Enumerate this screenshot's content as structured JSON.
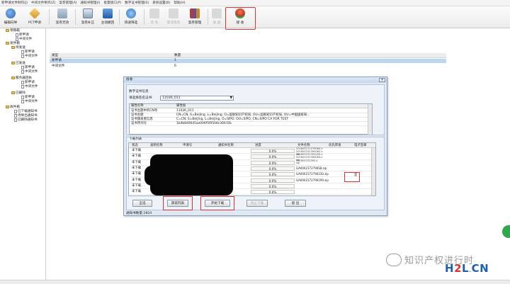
{
  "menubar": {
    "items": [
      "新申请文件制作(J)",
      "中间文件制作(Z)",
      "案卷管理(A)",
      "通知书管理(I)",
      "批量接口(P)",
      "数字证书管理(S)",
      "系统设置(B)",
      "帮助(H)"
    ]
  },
  "toolbar": {
    "buttons": [
      {
        "label": "编辑向导",
        "icon": "globe-icon",
        "color": "#3a78c8"
      },
      {
        "label": "PCT申请",
        "icon": "pct-icon",
        "color": "#e3a92e"
      },
      {
        "label": "案卷无效",
        "icon": "folder-icon",
        "color": "#8aa0b8"
      },
      {
        "label": "案卷补正",
        "icon": "doc-icon",
        "color": "#7b93b0"
      },
      {
        "label": "主动撤回",
        "icon": "note-icon",
        "color": "#2f6fc0"
      },
      {
        "label": "快速筛选",
        "icon": "filter-icon",
        "color": "#3a86c8"
      },
      {
        "label": "签 名",
        "icon": "sign-icon",
        "color": "#c8c8c8"
      },
      {
        "label": "取消签名",
        "icon": "unsign-icon",
        "color": "#c8c8c8"
      },
      {
        "label": "案卷管理",
        "icon": "books-icon",
        "color": "#b04a4a"
      },
      {
        "label": "发 送",
        "icon": "send-icon",
        "color": "#c8c8c8"
      },
      {
        "label": "接 收",
        "icon": "receive-icon",
        "color": "#d94a3a"
      }
    ]
  },
  "tree": {
    "nodes": [
      {
        "label": "草稿箱"
      },
      {
        "label": "新申请"
      },
      {
        "label": "中间文件"
      },
      {
        "label": "发件箱"
      },
      {
        "label": "待发送"
      },
      {
        "label": "新申请"
      },
      {
        "label": "中间文件"
      },
      {
        "label": "已发送"
      },
      {
        "label": "新申请"
      },
      {
        "label": "中间文件"
      },
      {
        "label": "服务器回执"
      },
      {
        "label": "新申请"
      },
      {
        "label": "中间文件"
      },
      {
        "label": "已删除"
      },
      {
        "label": "新申请"
      },
      {
        "label": "中间文件"
      },
      {
        "label": "收件箱"
      },
      {
        "label": "已下载通知书"
      },
      {
        "label": "待导出通知书"
      },
      {
        "label": "已删除通知书"
      }
    ]
  },
  "mainlist": {
    "headers": {
      "type": "类型",
      "count": "数量"
    },
    "rows": [
      {
        "type": "新申请",
        "count": "1"
      },
      {
        "type": "中间文件",
        "count": "6"
      }
    ]
  },
  "dialog": {
    "title": "接收",
    "close": "✕",
    "cert_group": {
      "title": "数字证书信息",
      "select_label": "请选择签名证书:",
      "select_value": "11036_011",
      "prop_headers": {
        "name": "属性名称",
        "value": "属性值"
      },
      "props": [
        {
          "name": "证书主题中的CN项",
          "value": "11036_011"
        },
        {
          "name": "证书主题",
          "value": "CN=CN, S=BeiJing, L=BeiJing, O=国家知识产权局, OU=国家知识产权局, OU=中国国家知..."
        },
        {
          "name": "证书颁发者信息",
          "value": "C=CN, S=BeiJing, L=BeiJing, O=SIPO, OU=SIPO, CN=SIPO CA FOR TEST"
        },
        {
          "name": "证书序列号",
          "value": "1b4b8406d5ae006f5f0508c36fcf2b"
        }
      ]
    },
    "list_group": {
      "title": "下载列表",
      "headers": {
        "status": "状态",
        "applicant": "发明名称",
        "appno": "申请号",
        "notice": "通知书名称",
        "progress": "进度",
        "filename": "文件名称",
        "priority": "优先审查",
        "electronic": "电子签章"
      },
      "rows": [
        {
          "status": "未下载",
          "progress": "0.0%",
          "filename": "201605171279064.z\n201605152300062.z\nzip"
        },
        {
          "status": "未下载",
          "progress": "0.0%",
          "filename": "201605152301050.z\n201605152300063.z\nzip"
        },
        {
          "status": "未下载",
          "progress": "0.0%",
          "filename": "201605152300.z\nzip"
        },
        {
          "status": "未下载",
          "progress": "0.0%",
          "filename": "GA0002172790S8.zip"
        },
        {
          "status": "未下载",
          "progress": "0.0%",
          "filename": "GA0002172790330.zip",
          "electronic": "是"
        },
        {
          "status": "未下载",
          "progress": "0.0%",
          "filename": "GA0002172790199.zip"
        },
        {
          "status": "未下载",
          "progress": "0.0%",
          "filename": ""
        },
        {
          "status": "未下载",
          "progress": "0.0%",
          "filename": ""
        }
      ],
      "count_label": "通知书数量:2824"
    },
    "buttons": {
      "select_all": "全选",
      "get_list": "获取列表",
      "start_download": "开始下载",
      "stop_download": "停止下载",
      "exit": "退 出"
    }
  },
  "watermark": {
    "text": "知识产权进行时",
    "site_prefix": "H",
    "site_two": "2",
    "site_rest": "L",
    "site_dot": ".",
    "site_cn": "CN"
  }
}
